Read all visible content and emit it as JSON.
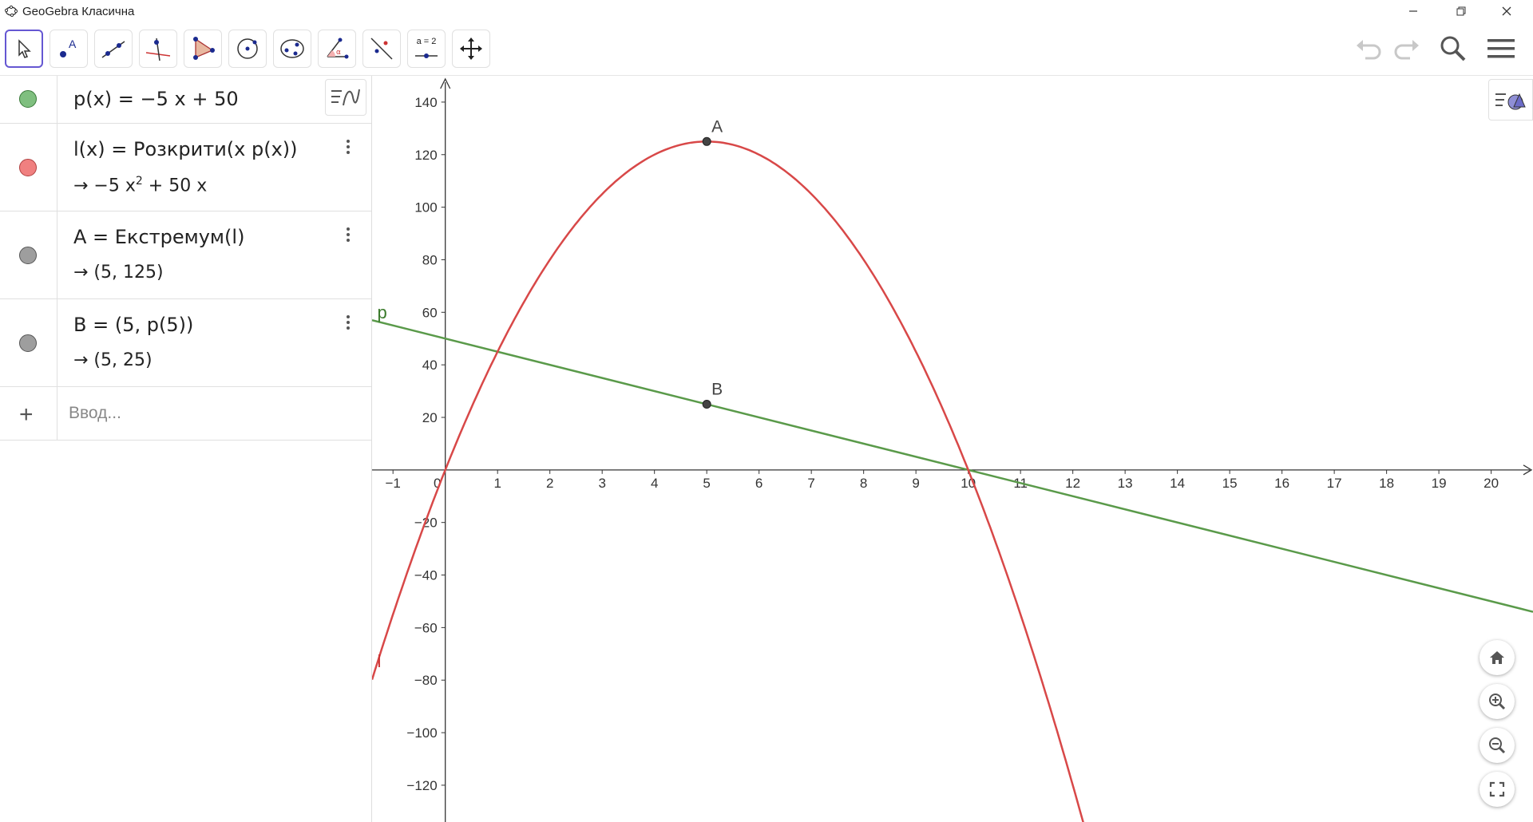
{
  "window": {
    "title": "GeoGebra Класична"
  },
  "toolbar": {
    "tools": [
      "move-tool",
      "point-tool",
      "line-tool",
      "perpendicular-line-tool",
      "polygon-tool",
      "circle-tool",
      "conic-tool",
      "angle-tool",
      "reflect-tool",
      "slider-tool",
      "move-graphics-tool"
    ],
    "slider_label": "a = 2"
  },
  "algebra": {
    "rows": [
      {
        "definition": "p(x)  =  −5 x + 50",
        "color": "#7fbf7f"
      },
      {
        "definition": "l(x)  =  Розкрити(x p(x))",
        "value_prefix": "→  −5 x",
        "value_sup": "2",
        "value_suffix": " + 50 x",
        "color": "#f08080"
      },
      {
        "definition": "A  =  Екстремум(l)",
        "value": "→ (5, 125)",
        "color": "#9e9e9e"
      },
      {
        "definition": "B  =  (5, p(5))",
        "value": "→ (5, 25)",
        "color": "#9e9e9e"
      }
    ],
    "input_placeholder": "Ввод..."
  },
  "graph": {
    "x_ticks": [
      "−1",
      "0",
      "1",
      "2",
      "3",
      "4",
      "5",
      "6",
      "7",
      "8",
      "9",
      "10",
      "11",
      "12",
      "13",
      "14",
      "15",
      "16",
      "17",
      "18",
      "19",
      "20"
    ],
    "y_ticks": [
      "140",
      "120",
      "100",
      "80",
      "60",
      "40",
      "20",
      "−20",
      "−40",
      "−60",
      "−80",
      "−100",
      "−120"
    ],
    "line_label": "p",
    "curve_label": "l",
    "point_A": {
      "label": "A",
      "x": 5,
      "y": 125
    },
    "point_B": {
      "label": "B",
      "x": 5,
      "y": 25
    },
    "line_color": "#5a9a4a",
    "curve_color": "#d84848",
    "xlim": [
      -1.4,
      20.8
    ],
    "ylim": [
      -134,
      150
    ]
  }
}
